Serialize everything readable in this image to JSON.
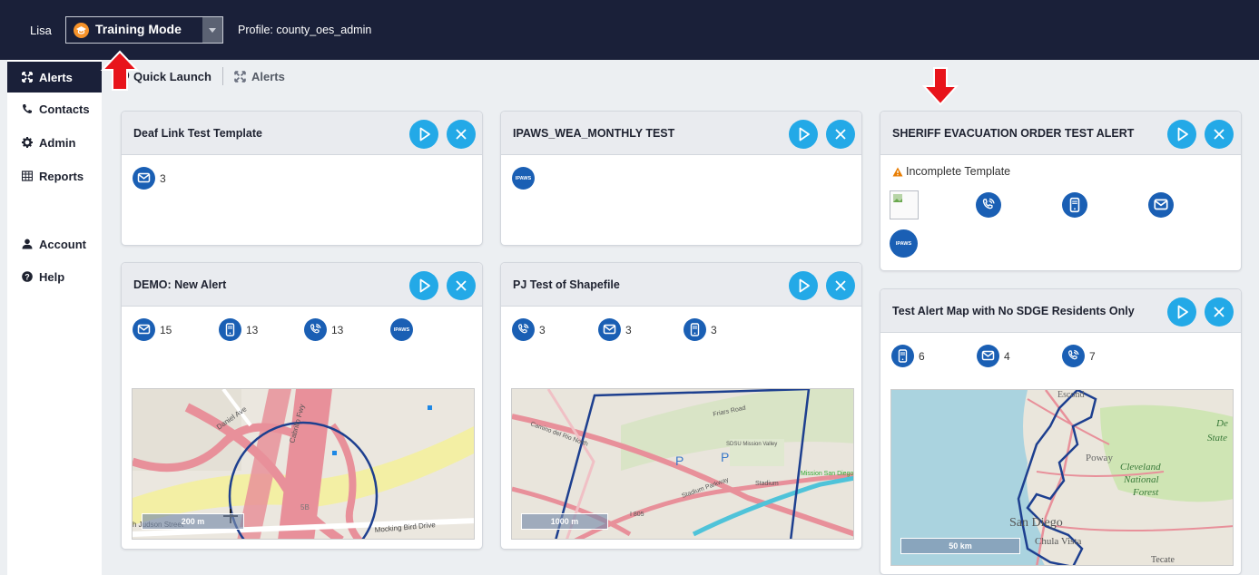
{
  "topbar": {
    "user": "Lisa",
    "mode": "Training Mode",
    "profile": "Profile: county_oes_admin"
  },
  "sidebar": {
    "items": [
      {
        "label": "Alerts",
        "icon": "expand-arrows-icon"
      },
      {
        "label": "Contacts",
        "icon": "phone-icon"
      },
      {
        "label": "Admin",
        "icon": "gear-icon"
      },
      {
        "label": "Reports",
        "icon": "table-icon"
      },
      {
        "label": "Account",
        "icon": "user-icon"
      },
      {
        "label": "Help",
        "icon": "question-circle-icon"
      }
    ]
  },
  "breadcrumb": {
    "quick_launch": "Quick Launch",
    "alerts": "Alerts"
  },
  "cards": [
    {
      "title": "Deaf Link Test Template",
      "channels": [
        {
          "type": "email",
          "count": "3"
        }
      ]
    },
    {
      "title": "IPAWS_WEA_MONTHLY TEST",
      "channels": [
        {
          "type": "ipaws",
          "label": "IPAWS"
        }
      ]
    },
    {
      "title": "SHERIFF EVACUATION ORDER TEST ALERT",
      "warning": "Incomplete Template",
      "channels": [
        {
          "type": "image"
        },
        {
          "type": "voice"
        },
        {
          "type": "sms"
        },
        {
          "type": "email"
        },
        {
          "type": "ipaws",
          "label": "IPAWS"
        }
      ]
    },
    {
      "title": "DEMO: New Alert",
      "channels": [
        {
          "type": "email",
          "count": "15"
        },
        {
          "type": "sms",
          "count": "13"
        },
        {
          "type": "voice",
          "count": "13"
        },
        {
          "type": "ipaws",
          "label": "IPAWS"
        }
      ],
      "map": {
        "scale": "200 m",
        "labels": [
          "Daniel Ave",
          "Cabrillo Fwy",
          "h Judson Street",
          "Mocking Bird Drive",
          "5B"
        ]
      }
    },
    {
      "title": "PJ Test of Shapefile",
      "channels": [
        {
          "type": "voice",
          "count": "3"
        },
        {
          "type": "email",
          "count": "3"
        },
        {
          "type": "sms",
          "count": "3"
        }
      ],
      "map": {
        "scale": "1000 m",
        "labels": [
          "Stadium",
          "Mission San Diego",
          "Friars Road",
          "Camino del Rio North",
          "I 805",
          "SDSU Mission Valley",
          "Stadium Parkway"
        ]
      }
    },
    {
      "title": "Test Alert Map with No SDGE Residents Only",
      "channels": [
        {
          "type": "sms",
          "count": "6"
        },
        {
          "type": "email",
          "count": "4"
        },
        {
          "type": "voice",
          "count": "7"
        }
      ],
      "map": {
        "scale": "50 km",
        "labels": [
          "Escond",
          "Poway",
          "Cleveland",
          "National",
          "Forest",
          "San Diego",
          "Chula Vista",
          "Tecate",
          "De",
          "State"
        ]
      }
    }
  ],
  "colors": {
    "navy": "#1a2039",
    "action_blue": "#23a9e7",
    "channel_blue": "#1a5fb4",
    "mode_orange": "#f7932a",
    "arrow_red": "#e8141b",
    "warning": "#e87e04"
  }
}
